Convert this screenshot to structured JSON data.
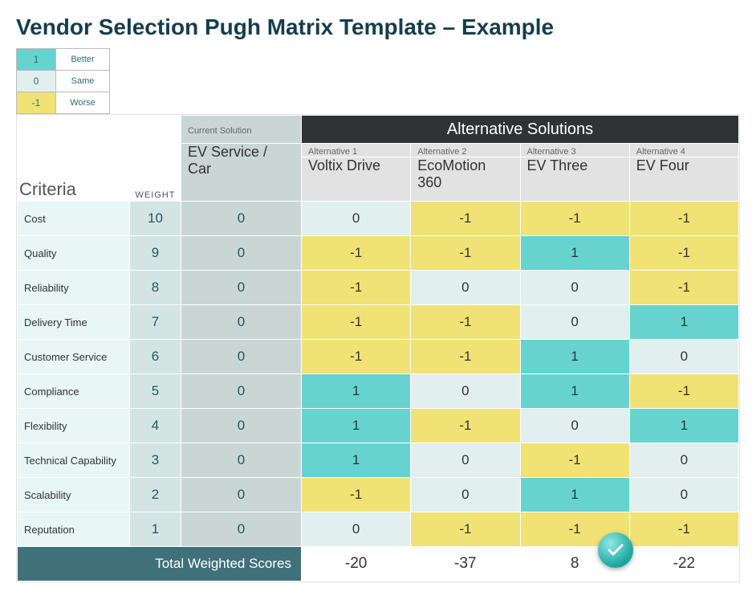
{
  "title": "Vendor Selection Pugh Matrix Template – Example",
  "legend": [
    {
      "num": "1",
      "label": "Better",
      "cls": "c-teal"
    },
    {
      "num": "0",
      "label": "Same",
      "cls": "c-pale"
    },
    {
      "num": "-1",
      "label": "Worse",
      "cls": "c-yellow"
    }
  ],
  "headings": {
    "criteria": "Criteria",
    "weight": "WEIGHT",
    "current_small": "Current Solution",
    "current_big": "EV Service / Car",
    "alt_band": "Alternative Solutions",
    "alts": [
      {
        "small": "Alternative 1",
        "big": "Voltix Drive"
      },
      {
        "small": "Alternative 2",
        "big": "EcoMotion 360"
      },
      {
        "small": "Alternative 3",
        "big": "EV Three"
      },
      {
        "small": "Alternative 4",
        "big": "EV Four"
      }
    ]
  },
  "rows": [
    {
      "crit": "Cost",
      "wt": "10",
      "curr": "0",
      "s": [
        "0",
        "-1",
        "-1",
        "-1"
      ]
    },
    {
      "crit": "Quality",
      "wt": "9",
      "curr": "0",
      "s": [
        "-1",
        "-1",
        "1",
        "-1"
      ]
    },
    {
      "crit": "Reliability",
      "wt": "8",
      "curr": "0",
      "s": [
        "-1",
        "0",
        "0",
        "-1"
      ]
    },
    {
      "crit": "Delivery Time",
      "wt": "7",
      "curr": "0",
      "s": [
        "-1",
        "-1",
        "0",
        "1"
      ]
    },
    {
      "crit": "Customer Service",
      "wt": "6",
      "curr": "0",
      "s": [
        "-1",
        "-1",
        "1",
        "0"
      ]
    },
    {
      "crit": "Compliance",
      "wt": "5",
      "curr": "0",
      "s": [
        "1",
        "0",
        "1",
        "-1"
      ]
    },
    {
      "crit": "Flexibility",
      "wt": "4",
      "curr": "0",
      "s": [
        "1",
        "-1",
        "0",
        "1"
      ]
    },
    {
      "crit": "Technical Capability",
      "wt": "3",
      "curr": "0",
      "s": [
        "1",
        "0",
        "-1",
        "0"
      ]
    },
    {
      "crit": "Scalability",
      "wt": "2",
      "curr": "0",
      "s": [
        "-1",
        "0",
        "1",
        "0"
      ]
    },
    {
      "crit": "Reputation",
      "wt": "1",
      "curr": "0",
      "s": [
        "0",
        "-1",
        "-1",
        "-1"
      ]
    }
  ],
  "totals": {
    "label": "Total Weighted Scores",
    "vals": [
      "-20",
      "-37",
      "8",
      "-22"
    ],
    "winner_index": 2
  },
  "score_colors": {
    "1": "c-teal",
    "0": "c-pale",
    "-1": "c-yellow"
  }
}
